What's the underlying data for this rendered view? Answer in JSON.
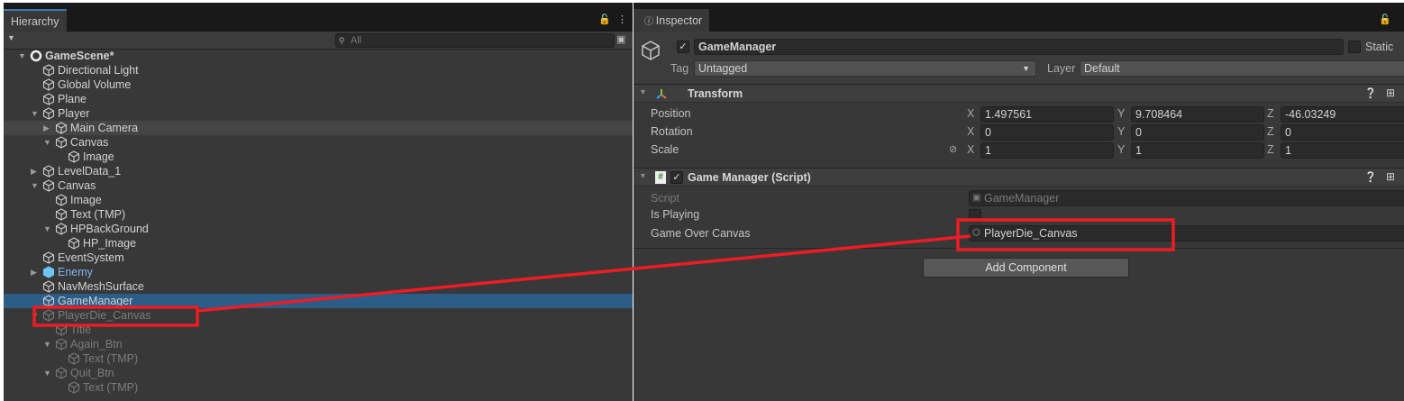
{
  "hierarchy": {
    "tab": "Hierarchy",
    "search_placeholder": "All",
    "items": [
      {
        "label": "GameScene*",
        "depth": 0,
        "arrow": "down",
        "icon": "unity-scene-icon",
        "bold": true
      },
      {
        "label": "Directional Light",
        "depth": 1,
        "icon": "cube-icon"
      },
      {
        "label": "Global Volume",
        "depth": 1,
        "icon": "cube-icon"
      },
      {
        "label": "Plane",
        "depth": 1,
        "icon": "cube-icon"
      },
      {
        "label": "Player",
        "depth": 1,
        "arrow": "down",
        "icon": "cube-icon"
      },
      {
        "label": "Main Camera",
        "depth": 2,
        "arrow": "right",
        "icon": "cube-icon",
        "hover": true
      },
      {
        "label": "Canvas",
        "depth": 2,
        "arrow": "down",
        "icon": "cube-icon"
      },
      {
        "label": "Image",
        "depth": 3,
        "icon": "cube-icon"
      },
      {
        "label": "LevelData_1",
        "depth": 1,
        "arrow": "right",
        "icon": "cube-icon"
      },
      {
        "label": "Canvas",
        "depth": 1,
        "arrow": "down",
        "icon": "cube-icon"
      },
      {
        "label": "Image",
        "depth": 2,
        "icon": "cube-icon"
      },
      {
        "label": "Text (TMP)",
        "depth": 2,
        "icon": "cube-icon"
      },
      {
        "label": "HPBackGround",
        "depth": 2,
        "arrow": "down",
        "icon": "cube-icon"
      },
      {
        "label": "HP_Image",
        "depth": 3,
        "icon": "cube-icon"
      },
      {
        "label": "EventSystem",
        "depth": 1,
        "icon": "cube-icon"
      },
      {
        "label": "Enemy",
        "depth": 1,
        "arrow": "right",
        "icon": "prefab-icon",
        "prefab": true
      },
      {
        "label": "NavMeshSurface",
        "depth": 1,
        "icon": "cube-icon"
      },
      {
        "label": "GameManager",
        "depth": 1,
        "icon": "cube-icon",
        "selected": true
      },
      {
        "label": "PlayerDie_Canvas",
        "depth": 1,
        "arrow": "down",
        "icon": "cube-icon",
        "inactive": true
      },
      {
        "label": "Title",
        "depth": 2,
        "icon": "cube-icon",
        "inactive": true
      },
      {
        "label": "Again_Btn",
        "depth": 2,
        "arrow": "down",
        "icon": "cube-icon",
        "inactive": true
      },
      {
        "label": "Text (TMP)",
        "depth": 3,
        "icon": "cube-icon",
        "inactive": true
      },
      {
        "label": "Quit_Btn",
        "depth": 2,
        "arrow": "down",
        "icon": "cube-icon",
        "inactive": true
      },
      {
        "label": "Text (TMP)",
        "depth": 3,
        "icon": "cube-icon",
        "inactive": true
      }
    ]
  },
  "inspector": {
    "tab": "Inspector",
    "object_name": "GameManager",
    "active": true,
    "static_label": "Static",
    "tag_label": "Tag",
    "tag_value": "Untagged",
    "layer_label": "Layer",
    "layer_value": "Default",
    "transform": {
      "title": "Transform",
      "position": {
        "label": "Position",
        "x": "1.497561",
        "y": "9.708464",
        "z": "-46.03249"
      },
      "rotation": {
        "label": "Rotation",
        "x": "0",
        "y": "0",
        "z": "0"
      },
      "scale": {
        "label": "Scale",
        "x": "1",
        "y": "1",
        "z": "1"
      },
      "axes": {
        "x": "X",
        "y": "Y",
        "z": "Z"
      }
    },
    "script_component": {
      "title": "Game Manager (Script)",
      "enabled": true,
      "script_label": "Script",
      "script_value": "GameManager",
      "is_playing_label": "Is Playing",
      "is_playing": false,
      "game_over_canvas_label": "Game Over Canvas",
      "game_over_canvas_value": "PlayerDie_Canvas"
    },
    "add_component": "Add Component"
  },
  "annotation_color": "#ee1c24"
}
